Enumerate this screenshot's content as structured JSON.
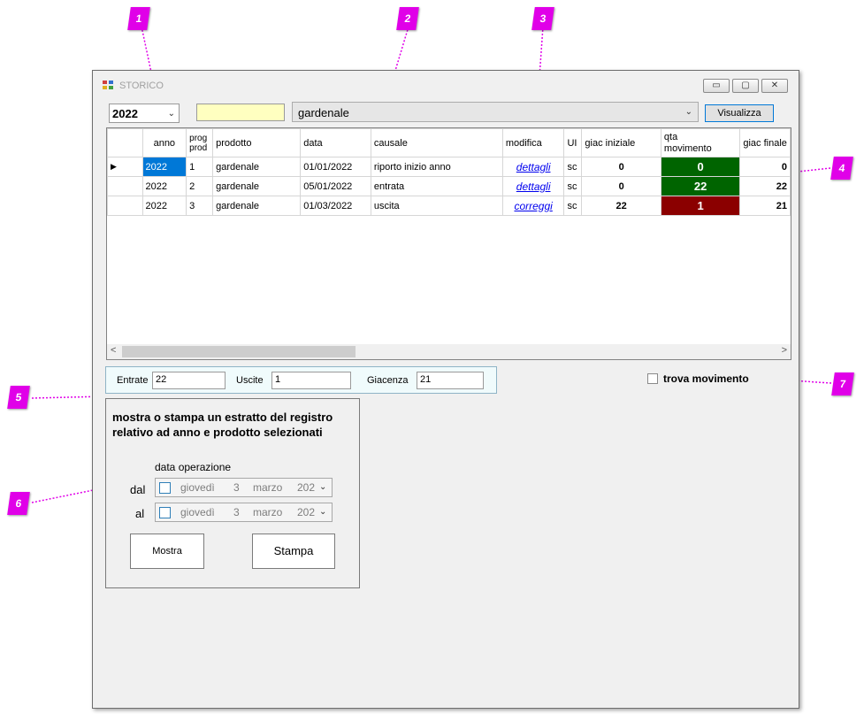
{
  "window": {
    "title": "STORICO",
    "buttons": [
      "▭",
      "▢",
      "✕"
    ]
  },
  "toolbar": {
    "year": "2022",
    "code_value": "",
    "product": "gardenale",
    "show_button": "Visualizza"
  },
  "grid": {
    "headers": [
      "anno",
      "prog prod",
      "prodotto",
      "data",
      "causale",
      "modifica",
      "UI",
      "giac iniziale",
      "qta movimento",
      "giac finale"
    ],
    "header_prog_line1": "prog",
    "header_prog_line2": "prod",
    "header_qta_line1": "qta",
    "header_qta_line2": "movimento",
    "rows": [
      {
        "anno": "2022",
        "prog": "1",
        "prodotto": "gardenale",
        "data": "01/01/2022",
        "causale": "riporto inizio anno",
        "modifica": "dettagli",
        "um": "sc",
        "giac_iniziale": "0",
        "qta": "0",
        "giac_finale": "0"
      },
      {
        "anno": "2022",
        "prog": "2",
        "prodotto": "gardenale",
        "data": "05/01/2022",
        "causale": "entrata",
        "modifica": "dettagli",
        "um": "sc",
        "giac_iniziale": "0",
        "qta": "22",
        "giac_finale": "22"
      },
      {
        "anno": "2022",
        "prog": "3",
        "prodotto": "gardenale",
        "data": "01/03/2022",
        "causale": "uscita",
        "modifica": "correggi",
        "um": "sc",
        "giac_iniziale": "22",
        "qta": "1",
        "giac_finale": "21"
      }
    ],
    "qta_colors": [
      "#006400",
      "#006400",
      "#8b0000"
    ]
  },
  "totals": {
    "entrate_label": "Entrate",
    "entrate": "22",
    "uscite_label": "Uscite",
    "uscite": "1",
    "giacenza_label": "Giacenza",
    "giacenza": "21"
  },
  "trova_label": "trova movimento",
  "panel": {
    "description": "mostra o stampa un estratto del registro relativo ad anno e prodotto selezionati",
    "data_operazione": "data operazione",
    "dal_label": "dal",
    "al_label": "al",
    "dal": {
      "weekday": "giovedì",
      "day": "3",
      "month": "marzo",
      "year": "202"
    },
    "al": {
      "weekday": "giovedì",
      "day": "3",
      "month": "marzo",
      "year": "202"
    },
    "mostra_button": "Mostra",
    "stampa_button": "Stampa"
  },
  "callouts": [
    "1",
    "2",
    "3",
    "4",
    "5",
    "6",
    "7"
  ],
  "accent_color": "#e000e8"
}
